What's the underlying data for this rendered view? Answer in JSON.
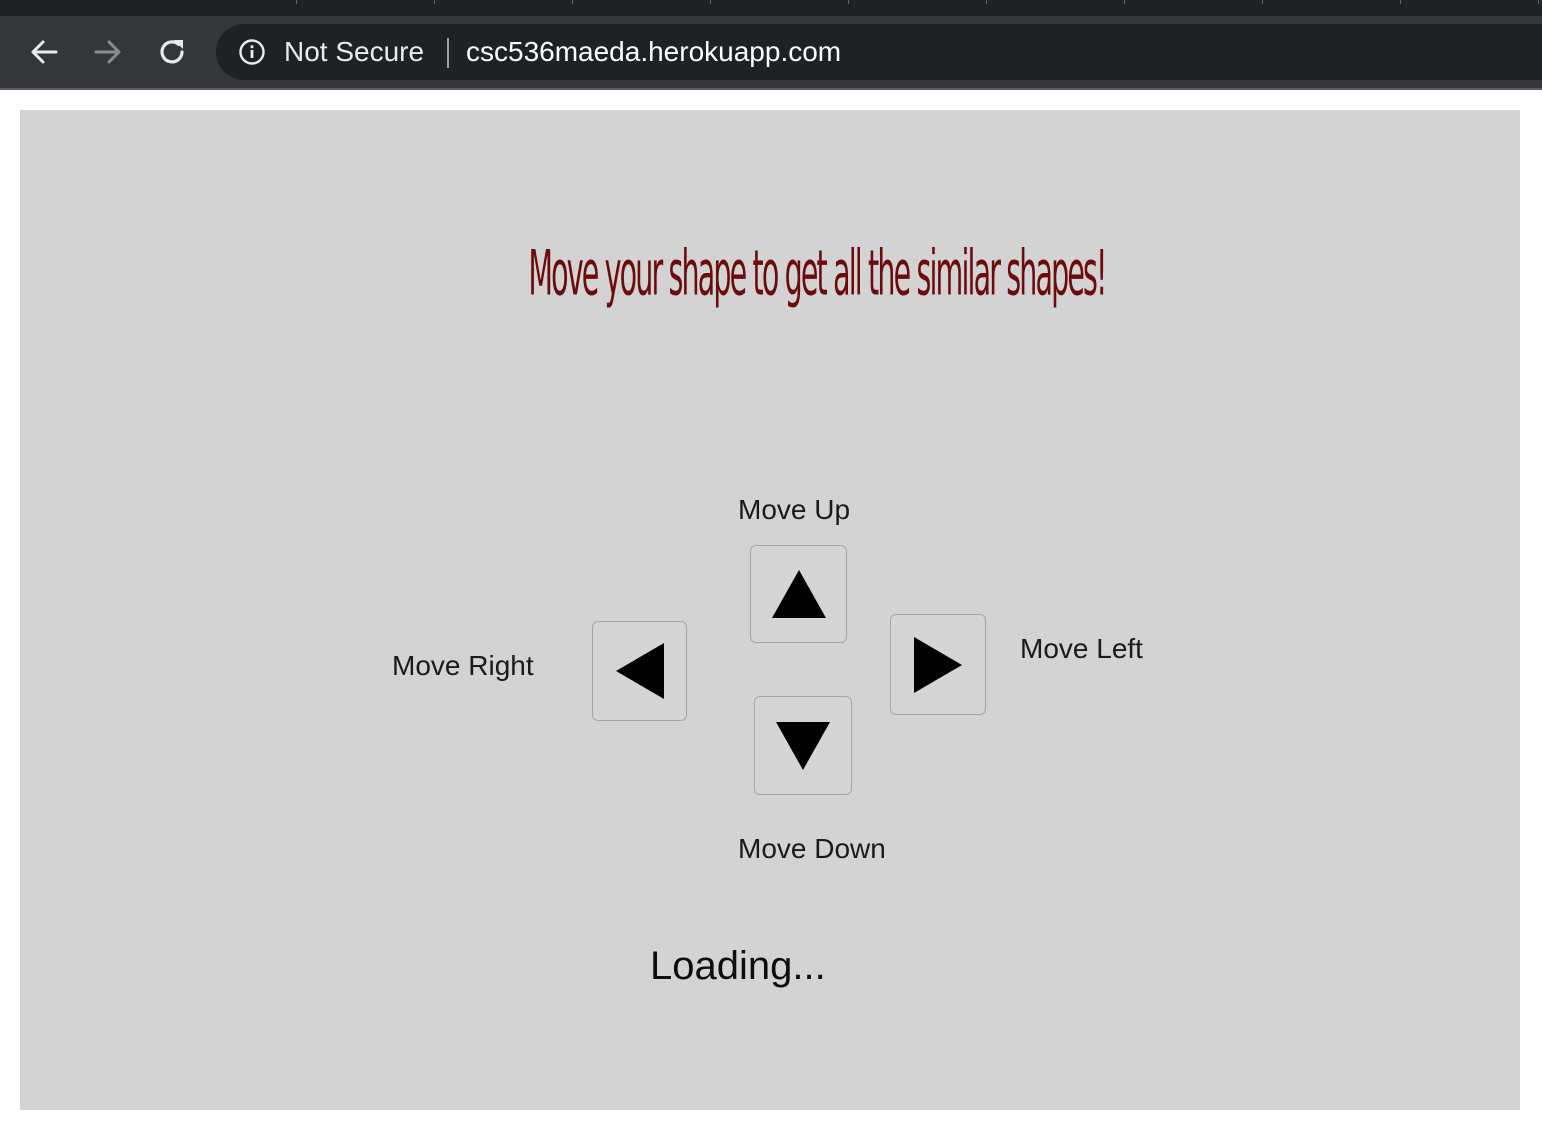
{
  "browser": {
    "security_label": "Not Secure",
    "url": "csc536maeda.herokuapp.com",
    "icons": {
      "back": "back-arrow-icon",
      "forward": "forward-arrow-icon",
      "reload": "reload-icon",
      "info": "info-icon"
    }
  },
  "game": {
    "instruction": "Move your shape to get all the similar shapes!",
    "controls": {
      "up_label": "Move Up",
      "down_label": "Move Down",
      "left_button_label": "Move Right",
      "right_button_label": "Move Left"
    },
    "status": "Loading...",
    "colors": {
      "canvas_background": "#d3d3d3",
      "instruction_text": "#6b0b0b"
    }
  }
}
